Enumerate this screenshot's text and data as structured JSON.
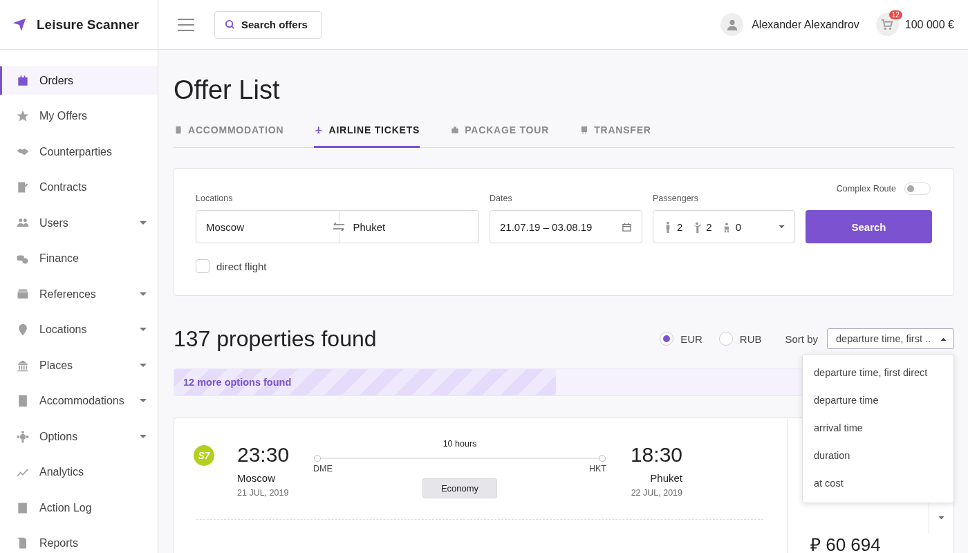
{
  "brand": {
    "name": "Leisure Scanner"
  },
  "header": {
    "search_button": "Search offers",
    "user_name": "Alexander Alexandrov",
    "cart_count": "12",
    "balance": "100 000 €"
  },
  "sidebar": {
    "items": [
      {
        "label": "Orders",
        "selected": true,
        "expandable": false
      },
      {
        "label": "My Offers",
        "selected": false,
        "expandable": false
      },
      {
        "label": "Counterparties",
        "selected": false,
        "expandable": false
      },
      {
        "label": "Contracts",
        "selected": false,
        "expandable": false
      },
      {
        "label": "Users",
        "selected": false,
        "expandable": true
      },
      {
        "label": "Finance",
        "selected": false,
        "expandable": false
      },
      {
        "label": "References",
        "selected": false,
        "expandable": true
      },
      {
        "label": "Locations",
        "selected": false,
        "expandable": true
      },
      {
        "label": "Places",
        "selected": false,
        "expandable": true
      },
      {
        "label": "Accommodations",
        "selected": false,
        "expandable": true
      },
      {
        "label": "Options",
        "selected": false,
        "expandable": true
      },
      {
        "label": "Analytics",
        "selected": false,
        "expandable": false
      },
      {
        "label": "Action Log",
        "selected": false,
        "expandable": false
      },
      {
        "label": "Reports",
        "selected": false,
        "expandable": false
      }
    ]
  },
  "page": {
    "title": "Offer List"
  },
  "tabs": [
    {
      "label": "ACCOMMODATION",
      "selected": false
    },
    {
      "label": "AIRLINE TICKETS",
      "selected": true
    },
    {
      "label": "PACKAGE TOUR",
      "selected": false
    },
    {
      "label": "TRANSFER",
      "selected": false
    }
  ],
  "search_form": {
    "complex_route": {
      "label": "Complex Route",
      "on": false
    },
    "locations": {
      "label": "Locations",
      "from": "Moscow",
      "to": "Phuket"
    },
    "dates": {
      "label": "Dates",
      "value": "21.07.19 – 03.08.19"
    },
    "passengers": {
      "label": "Passengers",
      "counts": [
        "2",
        "2",
        "0"
      ]
    },
    "search_button": "Search",
    "direct_flight": {
      "label": "direct flight",
      "checked": false
    }
  },
  "results": {
    "count_title": "137 properties found",
    "currencies": [
      {
        "label": "EUR",
        "selected": true
      },
      {
        "label": "RUB",
        "selected": false
      }
    ],
    "sort": {
      "label": "Sort by",
      "value": "departure time, first ..",
      "expanded": true,
      "options": [
        "departure time, first direct",
        "departure time",
        "arrival time",
        "duration",
        "at cost"
      ]
    },
    "banner": {
      "text": "12 more options found",
      "level": 0.49
    }
  },
  "flight": {
    "airline_logo": "S7",
    "depart_time": "23:30",
    "depart_city": "Moscow",
    "depart_date": "21 JUL, 2019",
    "duration": "10 hours",
    "from_code": "DME",
    "to_code": "HKT",
    "cabin": "Economy",
    "arrive_time": "18:30",
    "arrive_city": "Phuket",
    "arrive_date": "22 JUL, 2019",
    "price": "₽ 60 694"
  }
}
